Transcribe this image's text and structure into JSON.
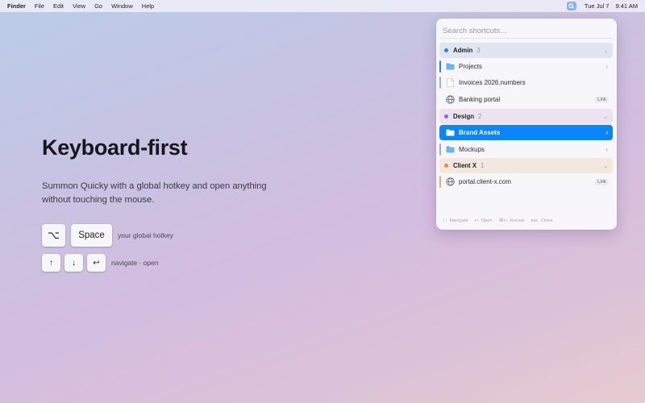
{
  "menubar": {
    "app_name": "Finder",
    "menus": [
      "File",
      "Edit",
      "View",
      "Go",
      "Window",
      "Help"
    ],
    "tray_icon": "quicky-tray-icon",
    "date": "Tue Jul 7",
    "time": "9:41 AM"
  },
  "hero": {
    "title": "Keyboard-first",
    "description": "Summon Quicky with a global hotkey and open anything without touching the mouse.",
    "hotkey": {
      "keys": [
        "⌥",
        "Space"
      ],
      "label": "your global hotkey"
    },
    "navigation": {
      "keys": [
        "↑",
        "↓",
        "↩"
      ],
      "label": "navigate · open"
    }
  },
  "panel": {
    "search_placeholder": "Search shortcuts…",
    "groups": [
      {
        "name": "Admin",
        "count": "3",
        "color": "#2d7ff9",
        "header_bg": "#dfe6f2",
        "collapse_glyph": "⌄",
        "items": [
          {
            "label": "Projects",
            "icon": "folder-icon",
            "trailing": "›"
          },
          {
            "label": "Invoices 2026.numbers",
            "icon": "document-icon",
            "trailing": ""
          },
          {
            "label": "Banking portal",
            "icon": "globe-icon",
            "tag": "Link"
          }
        ]
      },
      {
        "name": "Design",
        "count": "2",
        "color": "#a259e0",
        "header_bg": "#ece2f0",
        "collapse_glyph": "⌄",
        "items": [
          {
            "label": "Brand Assets",
            "icon": "folder-icon",
            "trailing": "›",
            "selected": true
          },
          {
            "label": "Mockups",
            "icon": "folder-icon",
            "trailing": "›"
          }
        ]
      },
      {
        "name": "Client X",
        "count": "1",
        "color": "#f08a24",
        "header_bg": "#f3e8dd",
        "collapse_glyph": "⌄",
        "items": [
          {
            "label": "portal.client-x.com",
            "icon": "globe-icon",
            "tag": "Link"
          }
        ]
      }
    ],
    "footer": [
      {
        "glyph": "↑↓",
        "label": "Navigate"
      },
      {
        "glyph": "↩",
        "label": "Open"
      },
      {
        "glyph": "⌘↩",
        "label": "Reveal"
      },
      {
        "glyph": "esc",
        "label": "Close"
      }
    ]
  }
}
